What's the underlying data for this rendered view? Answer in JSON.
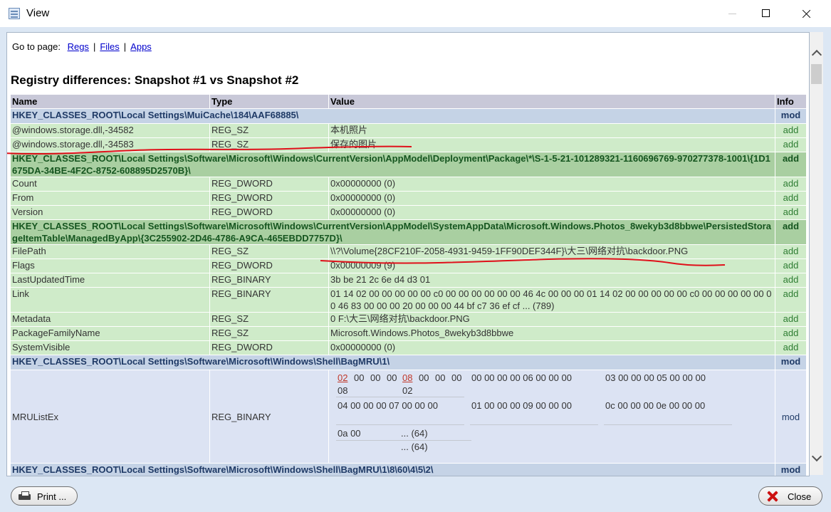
{
  "window": {
    "title": "View"
  },
  "nav": {
    "label": "Go to page:",
    "links": [
      "Regs",
      "Files",
      "Apps"
    ],
    "separator": "|"
  },
  "heading": "Registry differences: Snapshot #1 vs Snapshot #2",
  "table": {
    "headers": {
      "name": "Name",
      "type": "Type",
      "value": "Value",
      "info": "Info"
    },
    "rows": [
      {
        "kind": "key",
        "text": "HKEY_CLASSES_ROOT\\Local Settings\\MuiCache\\184\\AAF68885\\",
        "info": "mod"
      },
      {
        "kind": "val",
        "name": "@windows.storage.dll,-34582",
        "type": "REG_SZ",
        "value": "本机照片",
        "info": "add"
      },
      {
        "kind": "val",
        "name": "@windows.storage.dll,-34583",
        "type": "REG_SZ",
        "value": "保存的图片",
        "info": "add"
      },
      {
        "kind": "keyadd",
        "text": "HKEY_CLASSES_ROOT\\Local Settings\\Software\\Microsoft\\Windows\\CurrentVersion\\AppModel\\Deployment\\Package\\*\\S-1-5-21-101289321-1160696769-970277378-1001\\{1D1675DA-34BE-4F2C-8752-608895D2570B}\\",
        "info": "add"
      },
      {
        "kind": "val",
        "name": "Count",
        "type": "REG_DWORD",
        "value": "0x00000000 (0)",
        "info": "add"
      },
      {
        "kind": "val",
        "name": "From",
        "type": "REG_DWORD",
        "value": "0x00000000 (0)",
        "info": "add"
      },
      {
        "kind": "val",
        "name": "Version",
        "type": "REG_DWORD",
        "value": "0x00000000 (0)",
        "info": "add"
      },
      {
        "kind": "keyadd",
        "text": "HKEY_CLASSES_ROOT\\Local Settings\\Software\\Microsoft\\Windows\\CurrentVersion\\AppModel\\SystemAppData\\Microsoft.Windows.Photos_8wekyb3d8bbwe\\PersistedStorageItemTable\\ManagedByApp\\{3C255902-2D46-4786-A9CA-465EBDD7757D}\\",
        "info": "add"
      },
      {
        "kind": "val",
        "name": "FilePath",
        "type": "REG_SZ",
        "value": "\\\\?\\Volume{28CF210F-2058-4931-9459-1FF90DEF344F}\\大三\\网络对抗\\backdoor.PNG",
        "info": "add"
      },
      {
        "kind": "val",
        "name": "Flags",
        "type": "REG_DWORD",
        "value": "0x00000009 (9)",
        "info": "add"
      },
      {
        "kind": "val",
        "name": "LastUpdatedTime",
        "type": "REG_BINARY",
        "value": "3b be 21 2c 6e d4 d3 01",
        "info": "add"
      },
      {
        "kind": "val",
        "name": "Link",
        "type": "REG_BINARY",
        "value": "01 14 02 00 00 00 00 00 c0 00 00 00 00 00 00 46 4c 00 00 00 01 14 02 00 00 00 00 00 c0 00 00 00 00 00 00 46 83 00 00 00 20 00 00 00 44 bf c7 36 ef cf ... (789)",
        "info": "add"
      },
      {
        "kind": "val",
        "name": "Metadata",
        "type": "REG_SZ",
        "value": "0 F:\\大三\\网络对抗\\backdoor.PNG",
        "info": "add"
      },
      {
        "kind": "val",
        "name": "PackageFamilyName",
        "type": "REG_SZ",
        "value": "Microsoft.Windows.Photos_8wekyb3d8bbwe",
        "info": "add"
      },
      {
        "kind": "val",
        "name": "SystemVisible",
        "type": "REG_DWORD",
        "value": "0x00000000 (0)",
        "info": "add"
      },
      {
        "kind": "key",
        "text": "HKEY_CLASSES_ROOT\\Local Settings\\Software\\Microsoft\\Windows\\Shell\\BagMRU\\1\\",
        "info": "mod"
      },
      {
        "kind": "valmod",
        "name": "MRUListEx",
        "type": "REG_BINARY",
        "info": "mod"
      },
      {
        "kind": "key",
        "text": "HKEY_CLASSES_ROOT\\Local Settings\\Software\\Microsoft\\Windows\\Shell\\BagMRU\\1\\8\\60\\4\\5\\2\\",
        "info": "mod"
      }
    ]
  },
  "mru_diff": {
    "line1_a": [
      "02",
      "00",
      "00",
      "00",
      "08",
      "00",
      "00",
      "00"
    ],
    "line1_b": "00 00 00 00 06 00 00 00",
    "line1_c": "03 00 00 00 05 00 00 00",
    "line1_wrap_a": "08",
    "line1_wrap_b": "02",
    "line2_a": "04 00 00 00 07 00 00 00",
    "line2_b": "01 00 00 00 09 00 00 00",
    "line2_c": "0c 00 00 00 0e 00 00 00",
    "line3": "0a 00",
    "count1": "... (64)",
    "count2": "... (64)"
  },
  "buttons": {
    "print": "Print ...",
    "close": "Close"
  },
  "colors": {
    "key_row": "#c5d3e6",
    "added_key_row": "#a9cfa1",
    "added_value_row": "#cfebc9",
    "header_row": "#c8c8d8",
    "annotation": "#e0101a"
  }
}
